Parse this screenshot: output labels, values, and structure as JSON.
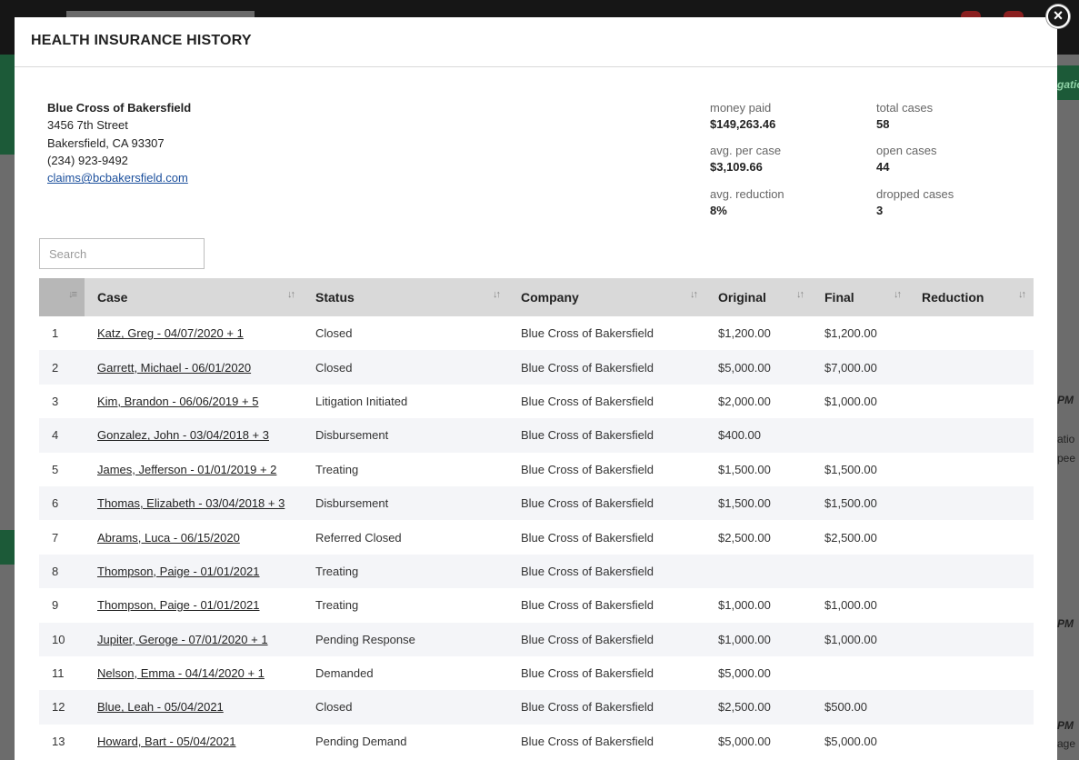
{
  "modal": {
    "title": "HEALTH INSURANCE HISTORY",
    "close_label": "×"
  },
  "contact": {
    "name": "Blue Cross of Bakersfield",
    "street": "3456 7th Street",
    "city": "Bakersfield, CA 93307",
    "phone": "(234) 923-9492",
    "email": "claims@bcbakersfield.com"
  },
  "stats": {
    "money_paid_label": "money paid",
    "money_paid": "$149,263.46",
    "total_cases_label": "total cases",
    "total_cases": "58",
    "avg_per_case_label": "avg. per case",
    "avg_per_case": "$3,109.66",
    "open_cases_label": "open cases",
    "open_cases": "44",
    "avg_reduction_label": "avg. reduction",
    "avg_reduction": "8%",
    "dropped_cases_label": "dropped cases",
    "dropped_cases": "3"
  },
  "search": {
    "placeholder": "Search"
  },
  "table": {
    "columns": [
      "Case",
      "Status",
      "Company",
      "Original",
      "Final",
      "Reduction"
    ],
    "rows": [
      {
        "n": "1",
        "case": "Katz, Greg - 04/07/2020 + 1",
        "status": "Closed",
        "company": "Blue Cross of Bakersfield",
        "original": "$1,200.00",
        "final": "$1,200.00",
        "reduction": ""
      },
      {
        "n": "2",
        "case": "Garrett, Michael - 06/01/2020",
        "status": "Closed",
        "company": "Blue Cross of Bakersfield",
        "original": "$5,000.00",
        "final": "$7,000.00",
        "reduction": ""
      },
      {
        "n": "3",
        "case": "Kim, Brandon - 06/06/2019 + 5",
        "status": "Litigation Initiated",
        "company": "Blue Cross of Bakersfield",
        "original": "$2,000.00",
        "final": "$1,000.00",
        "reduction": ""
      },
      {
        "n": "4",
        "case": "Gonzalez, John - 03/04/2018 + 3",
        "status": "Disbursement",
        "company": "Blue Cross of Bakersfield",
        "original": "$400.00",
        "final": "",
        "reduction": ""
      },
      {
        "n": "5",
        "case": "James, Jefferson - 01/01/2019 + 2",
        "status": "Treating",
        "company": "Blue Cross of Bakersfield",
        "original": "$1,500.00",
        "final": "$1,500.00",
        "reduction": ""
      },
      {
        "n": "6",
        "case": "Thomas, Elizabeth - 03/04/2018 + 3",
        "status": "Disbursement",
        "company": "Blue Cross of Bakersfield",
        "original": "$1,500.00",
        "final": "$1,500.00",
        "reduction": ""
      },
      {
        "n": "7",
        "case": "Abrams, Luca - 06/15/2020",
        "status": "Referred Closed",
        "company": "Blue Cross of Bakersfield",
        "original": "$2,500.00",
        "final": "$2,500.00",
        "reduction": ""
      },
      {
        "n": "8",
        "case": "Thompson, Paige - 01/01/2021",
        "status": "Treating",
        "company": "Blue Cross of Bakersfield",
        "original": "",
        "final": "",
        "reduction": ""
      },
      {
        "n": "9",
        "case": "Thompson, Paige - 01/01/2021",
        "status": "Treating",
        "company": "Blue Cross of Bakersfield",
        "original": "$1,000.00",
        "final": "$1,000.00",
        "reduction": ""
      },
      {
        "n": "10",
        "case": "Jupiter, Geroge - 07/01/2020 + 1",
        "status": "Pending Response",
        "company": "Blue Cross of Bakersfield",
        "original": "$1,000.00",
        "final": "$1,000.00",
        "reduction": ""
      },
      {
        "n": "11",
        "case": "Nelson, Emma - 04/14/2020 + 1",
        "status": "Demanded",
        "company": "Blue Cross of Bakersfield",
        "original": "$5,000.00",
        "final": "",
        "reduction": ""
      },
      {
        "n": "12",
        "case": "Blue, Leah - 05/04/2021",
        "status": "Closed",
        "company": "Blue Cross of Bakersfield",
        "original": "$2,500.00",
        "final": "$500.00",
        "reduction": ""
      },
      {
        "n": "13",
        "case": "Howard, Bart - 05/04/2021",
        "status": "Pending Demand",
        "company": "Blue Cross of Bakersfield",
        "original": "$5,000.00",
        "final": "$5,000.00",
        "reduction": ""
      }
    ]
  },
  "background": {
    "right_snippets": [
      "gatio",
      "PM",
      "atio",
      "pee",
      "PM",
      "PM",
      "age"
    ]
  },
  "colors": {
    "link": "#1b4f9c",
    "header_bg": "#d9d9d9",
    "row_alt": "#f4f5f8",
    "brand_green": "#1c5a38"
  }
}
